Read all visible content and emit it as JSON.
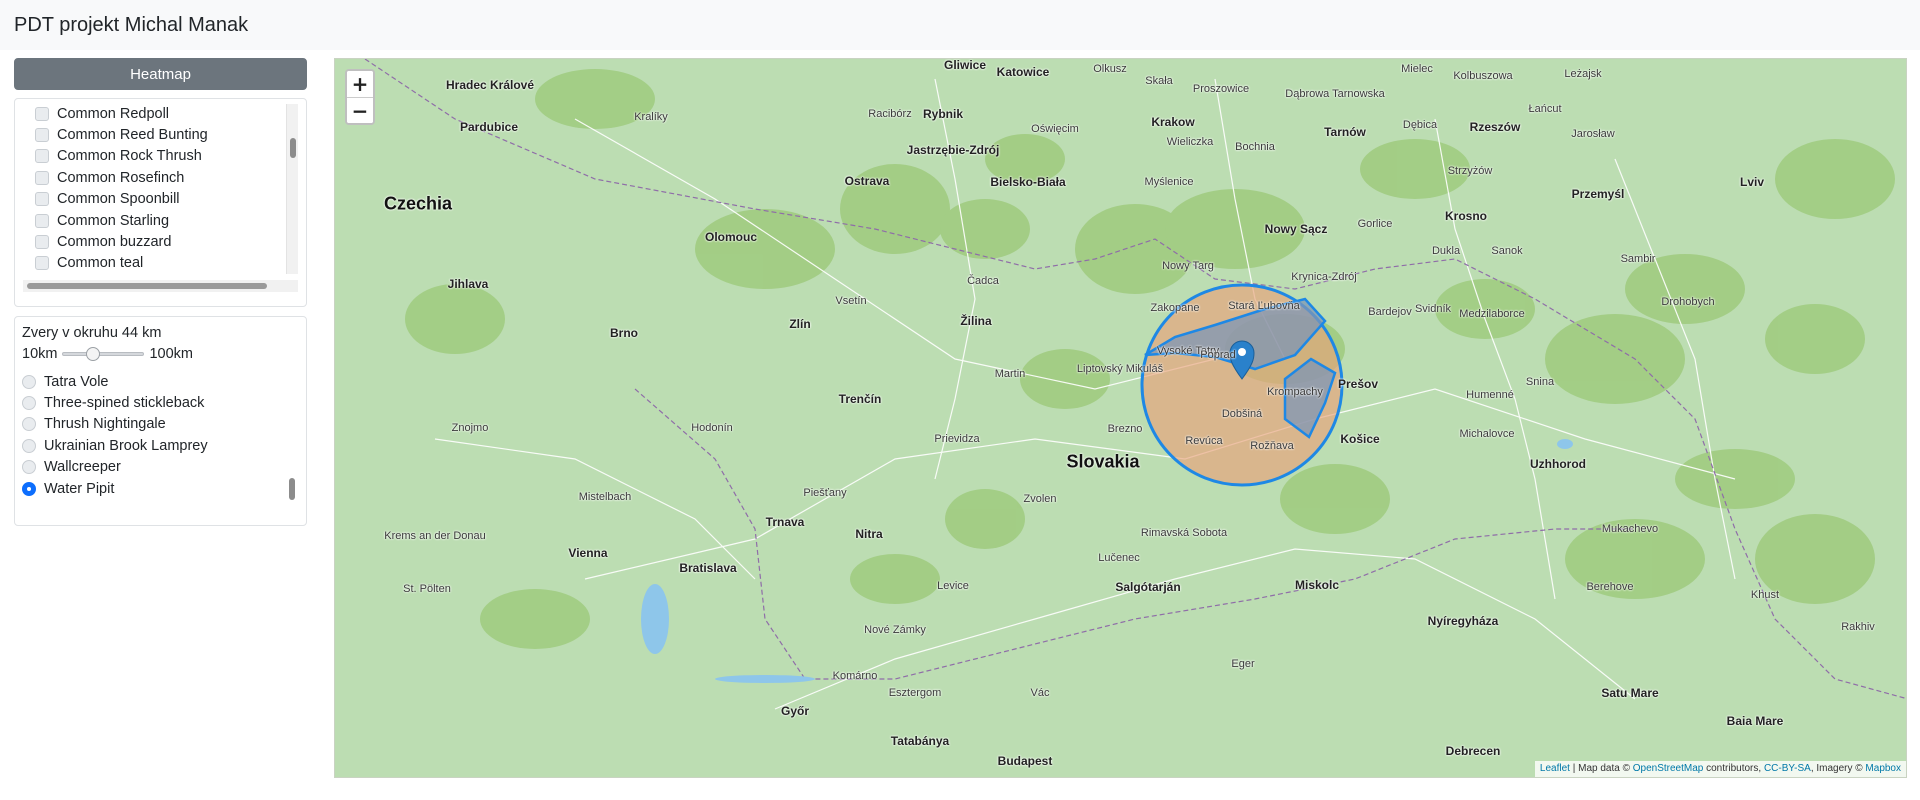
{
  "app": {
    "title": "PDT projekt Michal Manak"
  },
  "sidebar": {
    "heatmap_button": "Heatmap",
    "species_checklist": [
      "Common Redpoll",
      "Common Reed Bunting",
      "Common Rock Thrush",
      "Common Rosefinch",
      "Common Spoonbill",
      "Common Starling",
      "Common buzzard",
      "Common teal"
    ],
    "radius": {
      "title": "Zvery v okruhu 44 km",
      "min_label": "10km",
      "max_label": "100km",
      "value_km": 44,
      "min_km": 10,
      "max_km": 100
    },
    "animals": [
      {
        "label": "Tatra Vole",
        "selected": false
      },
      {
        "label": "Three-spined stickleback",
        "selected": false
      },
      {
        "label": "Thrush Nightingale",
        "selected": false
      },
      {
        "label": "Ukrainian Brook Lamprey",
        "selected": false
      },
      {
        "label": "Wallcreeper",
        "selected": false
      },
      {
        "label": "Water Pipit",
        "selected": true
      }
    ]
  },
  "map": {
    "zoom_in": "+",
    "zoom_out": "−",
    "attribution": {
      "leaflet": "Leaflet",
      "sep": " | Map data © ",
      "osm": "OpenStreetMap",
      "contrib": " contributors, ",
      "license": "CC-BY-SA",
      "imagery": ", Imagery © ",
      "mapbox": "Mapbox"
    },
    "colors": {
      "land": "#bcddb2",
      "forest": "#9fcb7e",
      "circle_stroke": "#1e88e5",
      "circle_fill": "#e8a27a",
      "polygon_fill": "#7e95b5",
      "marker": "#2a81cb"
    },
    "countries": [
      {
        "name": "Czechia"
      },
      {
        "name": "Slovakia"
      }
    ],
    "cities": [
      {
        "name": "Gliwice",
        "big": true
      },
      {
        "name": "Katowice",
        "big": true
      },
      {
        "name": "Hradec Králové",
        "big": true
      },
      {
        "name": "Olkusz",
        "big": false
      },
      {
        "name": "Skała",
        "big": false
      },
      {
        "name": "Proszowice",
        "big": false
      },
      {
        "name": "Dąbrowa Tarnowska",
        "big": false
      },
      {
        "name": "Mielec",
        "big": false
      },
      {
        "name": "Kolbuszowa",
        "big": false
      },
      {
        "name": "Leżajsk",
        "big": false
      },
      {
        "name": "Rybnik",
        "big": true
      },
      {
        "name": "Krakow",
        "big": true
      },
      {
        "name": "Tarnów",
        "big": true
      },
      {
        "name": "Dębica",
        "big": false
      },
      {
        "name": "Rzeszów",
        "big": true
      },
      {
        "name": "Łańcut",
        "big": false
      },
      {
        "name": "Jarosław",
        "big": false
      },
      {
        "name": "Pardubice",
        "big": true
      },
      {
        "name": "Kralíky",
        "big": false
      },
      {
        "name": "Racibórz",
        "big": false
      },
      {
        "name": "Oświęcim",
        "big": false
      },
      {
        "name": "Wieliczka",
        "big": false
      },
      {
        "name": "Bochnia",
        "big": false
      },
      {
        "name": "Jastrzębie-Zdrój",
        "big": true
      },
      {
        "name": "Ostrava",
        "big": true
      },
      {
        "name": "Bielsko-Biała",
        "big": true
      },
      {
        "name": "Myślenice",
        "big": false
      },
      {
        "name": "Strzyżów",
        "big": false
      },
      {
        "name": "Krosno",
        "big": true
      },
      {
        "name": "Przemyśl",
        "big": true
      },
      {
        "name": "Lviv",
        "big": true
      },
      {
        "name": "Nowy Sącz",
        "big": true
      },
      {
        "name": "Gorlice",
        "big": false
      },
      {
        "name": "Dukla",
        "big": false
      },
      {
        "name": "Sanok",
        "big": false
      },
      {
        "name": "Sambir",
        "big": false
      },
      {
        "name": "Drohobych",
        "big": false
      },
      {
        "name": "Olomouc",
        "big": true
      },
      {
        "name": "Jihlava",
        "big": true
      },
      {
        "name": "Brno",
        "big": true
      },
      {
        "name": "Zlín",
        "big": true
      },
      {
        "name": "Žilina",
        "big": true
      },
      {
        "name": "Trenčín",
        "big": true
      },
      {
        "name": "Čadca",
        "big": false
      },
      {
        "name": "Vsetín",
        "big": false
      },
      {
        "name": "Nowy Targ",
        "big": false
      },
      {
        "name": "Zakopane",
        "big": false
      },
      {
        "name": "Stará Ľubovňa",
        "big": false
      },
      {
        "name": "Krynica-Zdrój",
        "big": false
      },
      {
        "name": "Bardejov",
        "big": false
      },
      {
        "name": "Svidník",
        "big": false
      },
      {
        "name": "Medzilaborce",
        "big": false
      },
      {
        "name": "Vysoké Tatry",
        "big": false
      },
      {
        "name": "Poprad",
        "big": false
      },
      {
        "name": "Krompachy",
        "big": false
      },
      {
        "name": "Dobšiná",
        "big": false
      },
      {
        "name": "Rožňava",
        "big": false
      },
      {
        "name": "Revúca",
        "big": false
      },
      {
        "name": "Prešov",
        "big": true
      },
      {
        "name": "Košice",
        "big": true
      },
      {
        "name": "Humenné",
        "big": false
      },
      {
        "name": "Snina",
        "big": false
      },
      {
        "name": "Michalovce",
        "big": false
      },
      {
        "name": "Uzhhorod",
        "big": true
      },
      {
        "name": "Martin",
        "big": false
      },
      {
        "name": "Liptovský Mikuláš",
        "big": false
      },
      {
        "name": "Brezno",
        "big": false
      },
      {
        "name": "Prievidza",
        "big": false
      },
      {
        "name": "Nitra",
        "big": true
      },
      {
        "name": "Trnava",
        "big": true
      },
      {
        "name": "Bratislava",
        "big": true
      },
      {
        "name": "Vienna",
        "big": true
      },
      {
        "name": "Győr",
        "big": true
      },
      {
        "name": "Tatabánya",
        "big": true
      },
      {
        "name": "Budapest",
        "big": true
      },
      {
        "name": "Miskolc",
        "big": true
      },
      {
        "name": "Salgótarján",
        "big": true
      },
      {
        "name": "Nyíregyháza",
        "big": true
      },
      {
        "name": "Debrecen",
        "big": true
      },
      {
        "name": "Satu Mare",
        "big": true
      },
      {
        "name": "Baia Mare",
        "big": true
      },
      {
        "name": "Zvolen",
        "big": false
      },
      {
        "name": "Lučenec",
        "big": false
      },
      {
        "name": "Rimavská Sobota",
        "big": false
      },
      {
        "name": "Levice",
        "big": false
      },
      {
        "name": "Komárno",
        "big": false
      },
      {
        "name": "Nové Zámky",
        "big": false
      },
      {
        "name": "Piešťany",
        "big": false
      },
      {
        "name": "Hodonín",
        "big": false
      },
      {
        "name": "Znojmo",
        "big": false
      },
      {
        "name": "Krems an der Donau",
        "big": false
      },
      {
        "name": "St. Pölten",
        "big": false
      },
      {
        "name": "Mistelbach",
        "big": false
      },
      {
        "name": "Esztergom",
        "big": false
      },
      {
        "name": "Vác",
        "big": false
      },
      {
        "name": "Eger",
        "big": false
      },
      {
        "name": "Mukachevo",
        "big": false
      },
      {
        "name": "Berehove",
        "big": false
      },
      {
        "name": "Khust",
        "big": false
      },
      {
        "name": "Rakhiv",
        "big": false
      }
    ]
  }
}
